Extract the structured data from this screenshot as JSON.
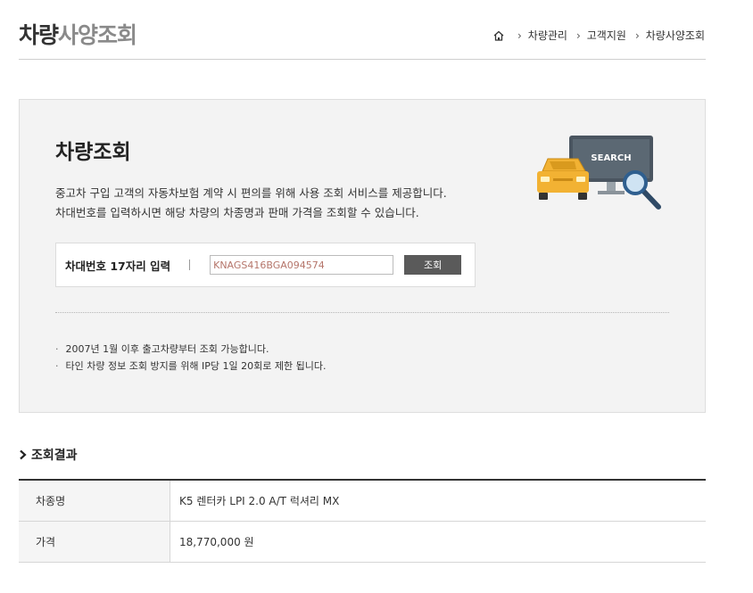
{
  "header": {
    "title_dark": "차량",
    "title_accent": "사양조회",
    "breadcrumb": [
      "차량관리",
      "고객지원",
      "차량사양조회"
    ],
    "breadcrumb_sep": "›"
  },
  "search": {
    "title": "차량조회",
    "description": [
      "중고차 구입 고객의 자동차보험 계약 시 편의를 위해 사용 조회 서비스를 제공합니다.",
      "차대번호를 입력하시면 해당 차량의 차종명과 판매 가격을 조회할 수 있습니다."
    ],
    "input_label": "차대번호 17자리 입력",
    "input_value": "KNAGS416BGA094574",
    "button_label": "조회",
    "illustration_label": "SEARCH",
    "notices": [
      "2007년 1월 이후 출고차량부터 조회 가능합니다.",
      "타인 차량 정보 조회 방지를 위해 IP당 1일 20회로 제한 됩니다."
    ]
  },
  "result": {
    "section_title": "조회결과",
    "rows": [
      {
        "label": "차종명",
        "value": "K5 렌터카 LPI 2.0 A/T 럭셔리 MX"
      },
      {
        "label": "가격",
        "value": "18,770,000 원"
      }
    ]
  },
  "colors": {
    "box_bg": "#f3f3f3",
    "button_bg": "#5a5a5a",
    "car_yellow": "#f2b233",
    "monitor": "#4a5560"
  }
}
